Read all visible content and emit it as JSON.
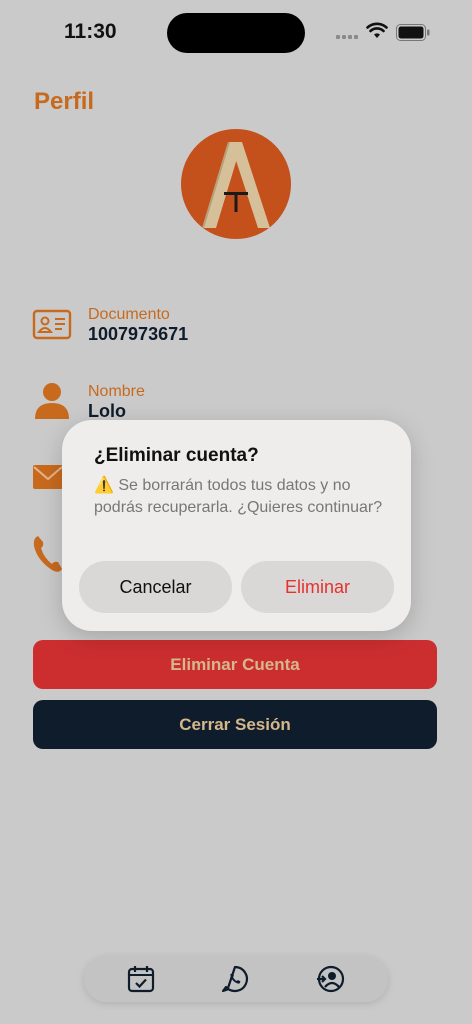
{
  "status_bar": {
    "time": "11:30"
  },
  "page": {
    "title": "Perfil"
  },
  "logo": {
    "letters": "AT",
    "bg_color": "#c4501c",
    "letter_color": "#d6c09a"
  },
  "fields": [
    {
      "label": "Documento",
      "value": "1007973671",
      "icon": "id-card-icon"
    },
    {
      "label": "Nombre",
      "value": "Lolo",
      "icon": "person-icon"
    }
  ],
  "hidden_icons": [
    "mail-icon",
    "phone-icon"
  ],
  "buttons": {
    "delete_account": "Eliminar Cuenta",
    "logout": "Cerrar Sesión"
  },
  "dialog": {
    "title": "¿Eliminar cuenta?",
    "warning_icon": "⚠️",
    "message": "Se borrarán todos tus datos y no podrás recuperarla. ¿Quieres continuar?",
    "cancel_label": "Cancelar",
    "confirm_label": "Eliminar"
  },
  "tab_bar": {
    "items": [
      {
        "icon": "calendar-check-icon"
      },
      {
        "icon": "whatsapp-icon"
      },
      {
        "icon": "profile-switch-icon"
      }
    ]
  },
  "colors": {
    "accent": "#c86a1e",
    "danger": "#cc2e30",
    "navy": "#0f1c2c",
    "button_text": "#d4b88a",
    "background": "#cacaca"
  }
}
